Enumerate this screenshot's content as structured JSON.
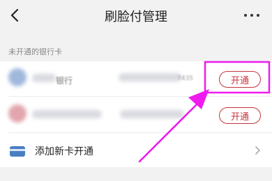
{
  "nav": {
    "back_icon": "chevron-left-icon",
    "title": "刷脸付管理",
    "more_icon": "more-horizontal-icon"
  },
  "section": {
    "title": "未开通的银行卡"
  },
  "cards": [
    {
      "bank_name": "银行",
      "number_tail": "7435",
      "action_label": "开通",
      "logo_color": "#9fb8dc"
    },
    {
      "action_label": "开通",
      "logo_color": "#e2a5ad"
    }
  ],
  "add_card": {
    "icon": "bank-card-icon",
    "label": "添加新卡开通",
    "chevron_icon": "chevron-right-icon"
  },
  "colors": {
    "accent": "#c8323c",
    "annotation": "#ee1bee",
    "card_icon": "#4a7fc1",
    "background": "#f2f2f2"
  }
}
